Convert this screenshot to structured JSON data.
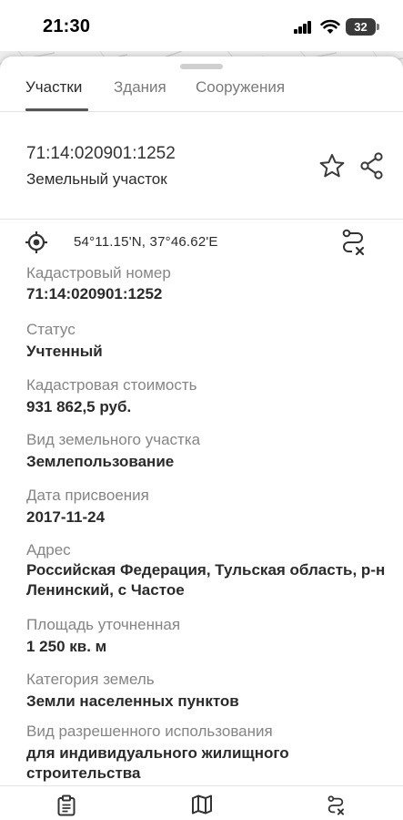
{
  "status_bar": {
    "time": "21:30",
    "battery": "32"
  },
  "tabs": [
    {
      "label": "Участки",
      "active": true
    },
    {
      "label": "Здания",
      "active": false
    },
    {
      "label": "Сооружения",
      "active": false
    }
  ],
  "header": {
    "parcel_id": "71:14:020901:1252",
    "parcel_type": "Земельный участок",
    "favorite_icon": "star-icon",
    "share_icon": "share-icon"
  },
  "location": {
    "coords": "54°11.15'N, 37°46.62'E",
    "locate_icon": "crosshair-icon",
    "route_icon": "route-icon"
  },
  "properties": [
    {
      "label": "Кадастровый номер",
      "value": "71:14:020901:1252"
    },
    {
      "label": "Статус",
      "value": "Учтенный"
    },
    {
      "label": "Кадастровая стоимость",
      "value": "931 862,5 руб."
    },
    {
      "label": "Вид земельного участка",
      "value": "Землепользование"
    },
    {
      "label": "Дата присвоения",
      "value": "2017-11-24"
    },
    {
      "label": "Адрес",
      "value": "Российская Федерация, Тульская область, р-н Ленинский, с Частое"
    },
    {
      "label": "Площадь уточненная",
      "value": "1 250 кв. м"
    },
    {
      "label": "Категория земель",
      "value": "Земли населенных пунктов"
    },
    {
      "label": "Вид разрешенного использования",
      "value": "для индивидуального жилищного строительства"
    }
  ],
  "bottom_nav": [
    {
      "icon": "clipboard-icon"
    },
    {
      "icon": "map-icon"
    },
    {
      "icon": "route-icon"
    }
  ],
  "colors": {
    "accent": "#2b2b2b",
    "muted": "#858585",
    "sheet": "#ffffff"
  }
}
